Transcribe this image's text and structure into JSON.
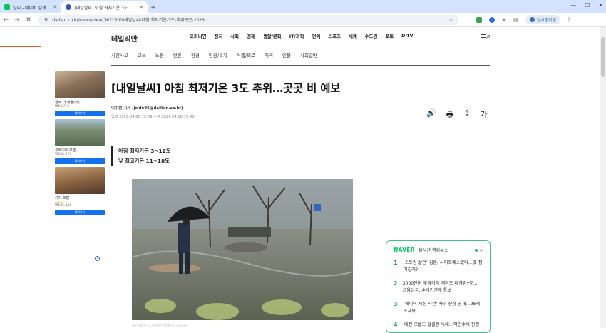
{
  "browser": {
    "tabs": [
      {
        "label": "날씨 - 네이버 검색",
        "active": false,
        "favicon_color": "#03c75a"
      },
      {
        "label": "[내일날씨] 아침 최저기온 3도…",
        "active": true,
        "favicon_color": "#2b5aa8"
      }
    ],
    "new_tab": "+",
    "url": "dailian.co.kr/news/view/1631300/내일날씨-아침-최저기온-3도-추위곳곳-2026",
    "profile_label": "일시중지됨",
    "window_controls": [
      "—",
      "☐",
      "✕"
    ]
  },
  "site": {
    "logo": "데일리안",
    "main_nav": [
      "오피니언",
      "정치",
      "사회",
      "경제",
      "생활/문화",
      "IT/과학",
      "연예",
      "스포츠",
      "세계",
      "수도권",
      "포토",
      "D-TV"
    ],
    "sub_nav": [
      "사건사고",
      "교육",
      "노동",
      "언론",
      "환경",
      "인권/복지",
      "식품/의료",
      "지역",
      "인물",
      "사회일반"
    ]
  },
  "ads": [
    {
      "name": "경주 더 써올(리)",
      "price": "₩58,716",
      "stars": "",
      "button": "예약하기",
      "color": "#a08870"
    },
    {
      "name": "포레이트 모텔",
      "price": "₩250,973",
      "stars": "",
      "button": "예약하기",
      "color": "#6b8c6a"
    },
    {
      "name": "지지 호텔",
      "price": "₩185,481",
      "stars": "★★★☆☆",
      "button": "예약하기",
      "color": "#8a6a4a"
    }
  ],
  "ad_info": "i",
  "article": {
    "headline": "[내일날씨] 아침 최저기온 3도 추위…곳곳 비 예보",
    "byline": "이수현 기자 (jwdo95@dailian.co.kr)",
    "dates": "입력 2026.04.08 19:39   수정 2026.04.08 19:40",
    "summary": [
      "아침 최저기온 3~12도",
      "낮 최고기온 11~18도"
    ],
    "caption": "비가 내리는 공원에서(연합뉴스) 자료사진"
  },
  "tools": [
    "🔊",
    "🖶",
    "⇪",
    "가"
  ],
  "ranking": {
    "brand": "NAVER",
    "title": "실시간 랭킹뉴스",
    "items": [
      {
        "num": "1",
        "text": "'스토킹 살인' 김훈, 사이코패스였다…몇 점이길래?"
      },
      {
        "num": "2",
        "text": "3000만원 부당이득 개미도 패가망신?… 금융당국, 수사기관에 통보"
      },
      {
        "num": "3",
        "text": "'케이어 시신 사건' 사위 신상 공개…26세 조재복"
      },
      {
        "num": "4",
        "text": "대전 오월드 탈출한 늑대…야간수색 진행"
      }
    ]
  }
}
